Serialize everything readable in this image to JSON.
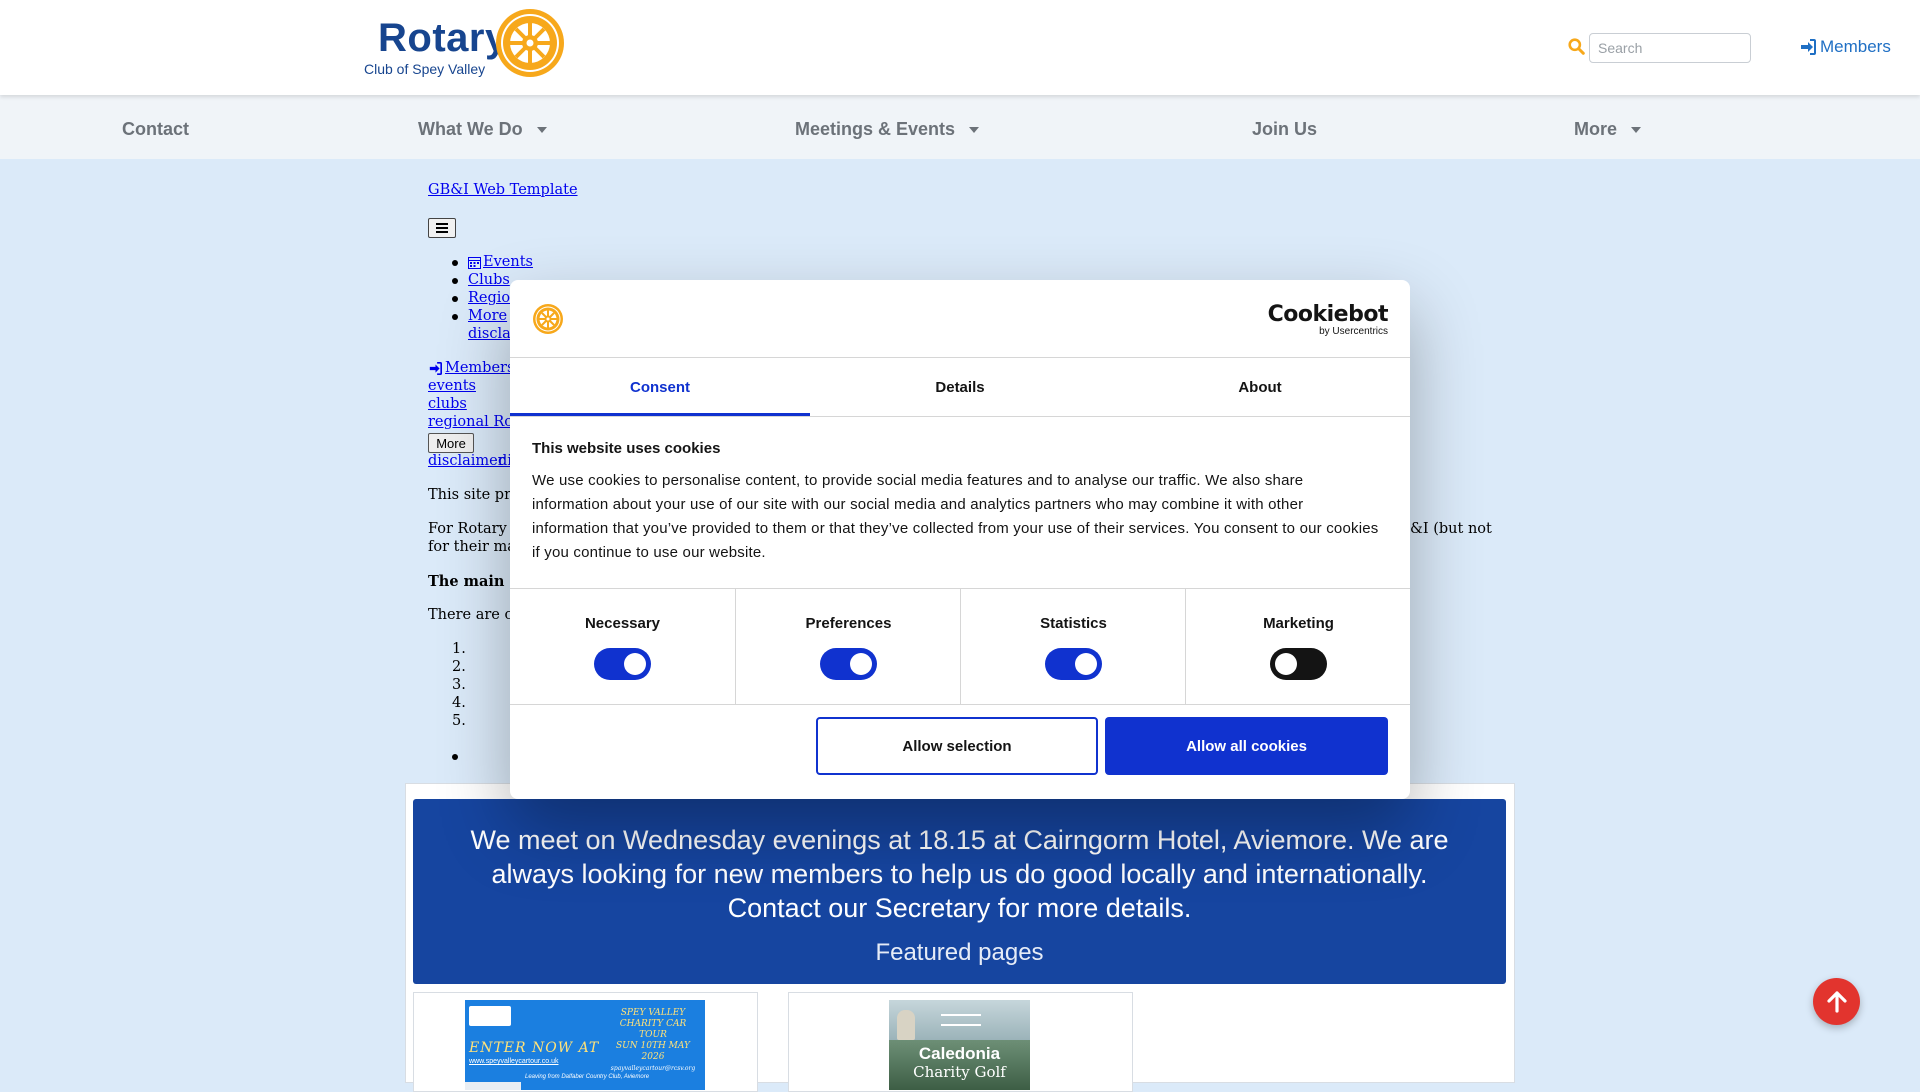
{
  "header": {
    "logo_word": "Rotary",
    "logo_sub": "Club of Spey Valley",
    "search_placeholder": "Search",
    "members_label": "Members"
  },
  "nav": {
    "items": [
      {
        "label": "Contact"
      },
      {
        "label": "What We Do"
      },
      {
        "label": "Meetings & Events"
      },
      {
        "label": "Join Us"
      },
      {
        "label": "More"
      }
    ]
  },
  "raw": {
    "template_link": "GB&I Web Template",
    "list1": [
      "Events",
      "Clubs",
      "Region",
      "More",
      "disclai"
    ],
    "members_link": "Members",
    "links": [
      "events",
      "clubs",
      "regional Rota"
    ],
    "more_button": "More",
    "disclaimer": "disclaimer",
    "disclaimer2": "di",
    "para1": "This site prov",
    "para2a": "For Rotary c",
    "para2b": "&I (but not",
    "para2c": "for their mai",
    "para3": "The main si",
    "para4": "There are cur",
    "ol": [
      "1.",
      "2.",
      "3.",
      "4.",
      "5."
    ]
  },
  "cookie": {
    "brand": "Cookiebot",
    "brand_sub": "by Usercentrics",
    "tabs": [
      "Consent",
      "Details",
      "About"
    ],
    "title": "This website uses cookies",
    "text": "We use cookies to personalise content, to provide social media features and to analyse our traffic. We also share information about your use of our site with our social media and analytics partners who may combine it with other information that you’ve provided to them or that they’ve collected from your use of their services. You consent to our cookies if you continue to use our website.",
    "categories": [
      {
        "label": "Necessary",
        "on": true
      },
      {
        "label": "Preferences",
        "on": true
      },
      {
        "label": "Statistics",
        "on": true
      },
      {
        "label": "Marketing",
        "on": false
      }
    ],
    "allow_selection": "Allow selection",
    "allow_all": "Allow all cookies"
  },
  "hero": {
    "text": "We meet on Wednesday evenings at 18.15 at Cairngorm Hotel, Aviemore. We are always looking for new members to help us do good locally and internationally. Contact our Secretary for more details.",
    "featured": "Featured pages"
  },
  "cards": {
    "card1": {
      "lines": [
        "SPEY VALLEY",
        "CHARITY CAR TOUR",
        "SUN 10TH MAY 2026",
        "spayvalleycartour@rcsv.org",
        "ENTER NOW AT",
        "www.speyvalleycartour.co.uk",
        "Leaving from Dalfaber Country Club, Aviemore"
      ]
    },
    "card2": {
      "title": "Caledonia",
      "sub": "Charity Golf"
    }
  },
  "colors": {
    "rotary_blue": "#17458f",
    "rotary_gold": "#f7a81b",
    "cookie_blue": "#1032cf",
    "hero_blue": "#1645a0",
    "scroll_red": "#e2342e"
  }
}
